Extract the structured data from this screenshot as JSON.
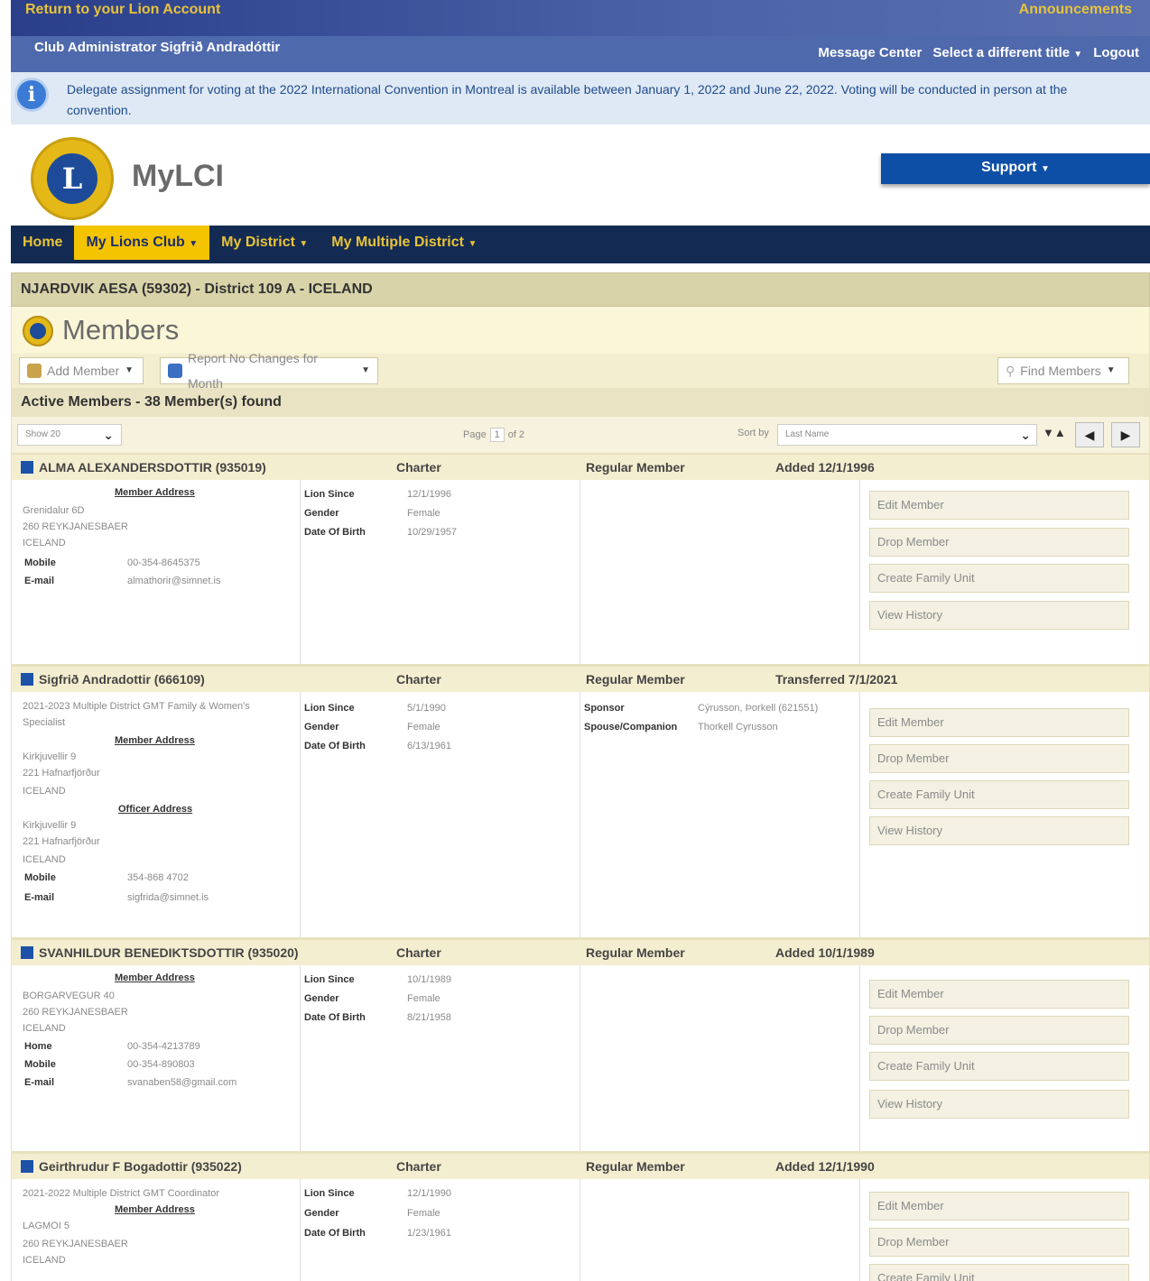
{
  "topbar": {
    "return_link": "Return to your Lion Account",
    "announcements": "Announcements"
  },
  "subbar": {
    "admin": "Club Administrator Sigfrið Andradóttir",
    "message_center": "Message Center",
    "select_title": "Select a different title",
    "logout": "Logout"
  },
  "info": {
    "text": "Delegate assignment for voting at the 2022 International Convention in Montreal is available between January 1, 2022 and June 22, 2022. Voting will be conducted in person at the convention."
  },
  "brand": {
    "name": "MyLCI",
    "logo_letter": "L",
    "support": "Support"
  },
  "nav": {
    "home": "Home",
    "club": "My Lions Club",
    "district": "My District",
    "multiple": "My Multiple District"
  },
  "club_title": "NJARDVIK AESA (59302) - District 109 A - ICELAND",
  "members_title": "Members",
  "tools": {
    "add_member": "Add Member",
    "report_no_changes": "Report No Changes for Month",
    "find_members": "Find Members"
  },
  "active_text": "Active Members - 38 Member(s) found",
  "pager": {
    "show": "Show 20",
    "page_label": "Page",
    "page": "1",
    "of": "of 2",
    "sort_label": "Sort by",
    "sort_value": "Last Name"
  },
  "labels": {
    "member_address": "Member Address",
    "officer_address": "Officer Address",
    "mobile": "Mobile",
    "email": "E-mail",
    "home": "Home",
    "lion_since": "Lion Since",
    "gender": "Gender",
    "dob": "Date Of Birth",
    "sponsor": "Sponsor",
    "spouse": "Spouse/Companion",
    "edit": "Edit Member",
    "drop": "Drop Member",
    "family": "Create Family Unit",
    "history": "View History"
  },
  "members": [
    {
      "name": "ALMA  ALEXANDERSDOTTIR    (935019)",
      "type": "Charter",
      "class": "Regular Member",
      "status": "Added 12/1/1996",
      "addr1": "Grenidalur 6D",
      "addr2": "260 REYKJANESBAER",
      "addr3": "ICELAND",
      "mobile": "00-354-8645375",
      "email": "almathorir@simnet.is",
      "since": "12/1/1996",
      "gender": "Female",
      "dob": "10/29/1957"
    },
    {
      "name": "Sigfrið  Andradottir    (666109)",
      "type": "Charter",
      "class": "Regular Member",
      "status": "Transferred 7/1/2021",
      "title1": "2021-2023 Multiple District GMT Family & Women's",
      "title2": "Specialist",
      "addr1": "Kirkjuvellir 9",
      "addr2": "221 Hafnarfjörður",
      "addr3": "ICELAND",
      "oaddr1": "Kirkjuvellir 9",
      "oaddr2": "221 Hafnarfjörður",
      "oaddr3": "ICELAND",
      "mobile": "354-868 4702",
      "email": "sigfrida@simnet.is",
      "since": "5/1/1990",
      "gender": "Female",
      "dob": "6/13/1961",
      "sponsor": "Cýrusson, Þorkell   (621551)",
      "spouse": "Thorkell Cyrusson"
    },
    {
      "name": "SVANHILDUR  BENEDIKTSDOTTIR    (935020)",
      "type": "Charter",
      "class": "Regular Member",
      "status": "Added 10/1/1989",
      "addr1": "BORGARVEGUR 40",
      "addr2": "260 REYKJANESBAER",
      "addr3": "ICELAND",
      "home": "00-354-4213789",
      "mobile": "00-354-890803",
      "email": "svanaben58@gmail.com",
      "since": "10/1/1989",
      "gender": "Female",
      "dob": "8/21/1958"
    },
    {
      "name": "Geirthrudur  F  Bogadottir    (935022)",
      "type": "Charter",
      "class": "Regular Member",
      "status": "Added 12/1/1990",
      "title1": "2021-2022 Multiple District GMT Coordinator",
      "addr1": "LAGMOI 5",
      "addr2": "260 REYKJANESBAER",
      "addr3": "ICELAND",
      "since": "12/1/1990",
      "gender": "Female",
      "dob": "1/23/1961"
    }
  ],
  "colors": {
    "nav_bg": "#132b53",
    "nav_text": "#e8c33a",
    "active_tab": "#f5c400",
    "support_bg": "#0d4fa6",
    "info_bg": "#dfe9f5",
    "club_bar": "#d9d3aa"
  },
  "icons": [
    "info-icon",
    "lions-logo",
    "caret-down-icon",
    "add-user-icon",
    "report-icon",
    "magnifier-icon",
    "chevron-down-icon",
    "sort-icon",
    "prev-arrow-icon",
    "next-arrow-icon",
    "member-square-icon"
  ]
}
